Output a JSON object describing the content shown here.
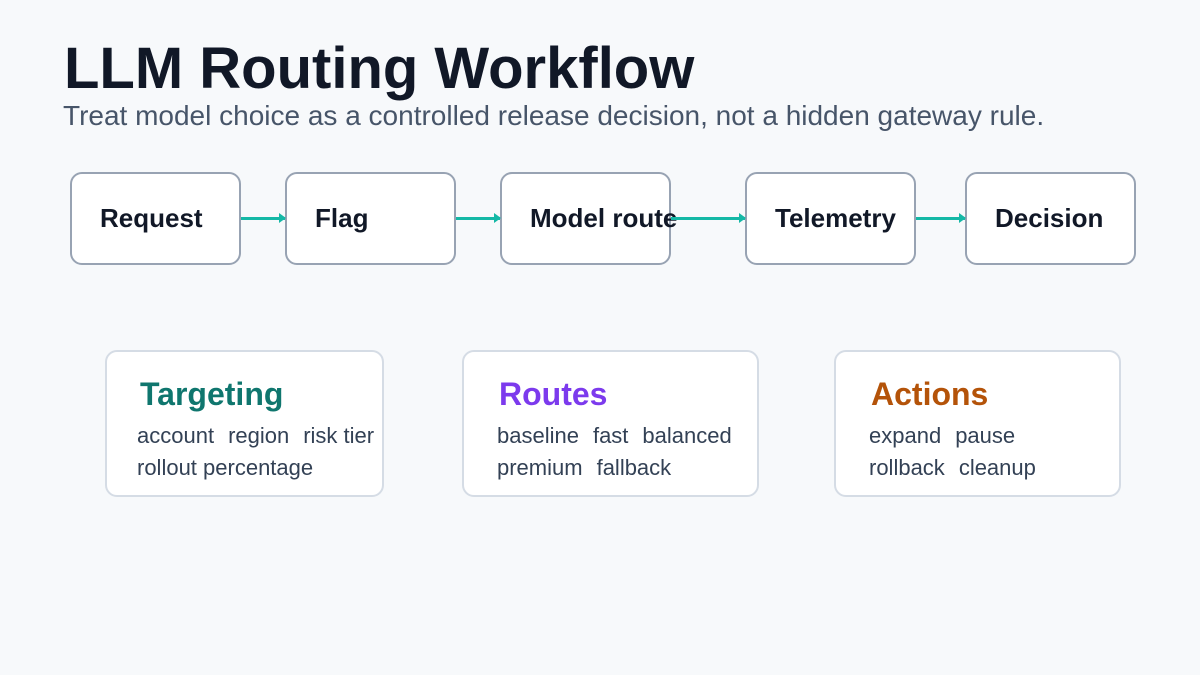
{
  "title": "LLM Routing Workflow",
  "subtitle": "Treat model choice as a controlled release decision, not a hidden gateway rule.",
  "steps": [
    {
      "label": "Request"
    },
    {
      "label": "Flag"
    },
    {
      "label": "Model route"
    },
    {
      "label": "Telemetry"
    },
    {
      "label": "Decision"
    }
  ],
  "cards": {
    "targeting": {
      "title": "Targeting",
      "line1": [
        "account",
        "region",
        "risk tier"
      ],
      "line2": [
        "rollout percentage"
      ]
    },
    "routes": {
      "title": "Routes",
      "line1": [
        "baseline",
        "fast",
        "balanced"
      ],
      "line2": [
        "premium",
        "fallback"
      ]
    },
    "actions": {
      "title": "Actions",
      "line1": [
        "expand",
        "pause"
      ],
      "line2": [
        "rollback",
        "cleanup"
      ]
    }
  },
  "colors": {
    "arrow": "#14b8a6",
    "targeting": "#0f766e",
    "routes": "#7c3aed",
    "actions": "#b45309"
  }
}
